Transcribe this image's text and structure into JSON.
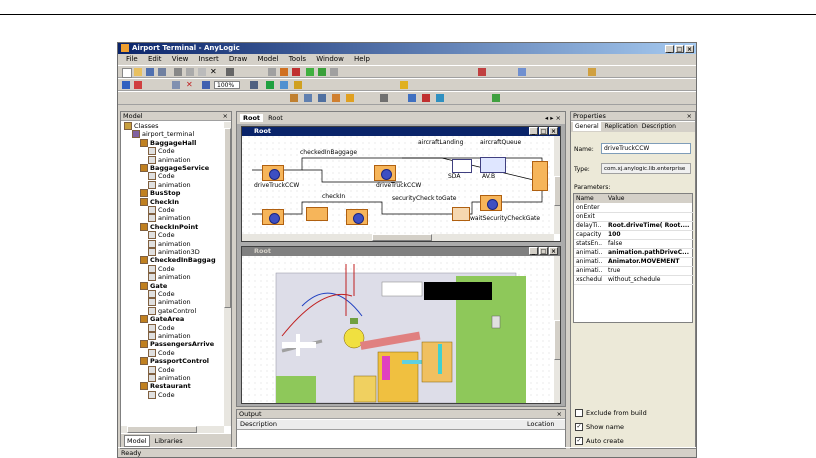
{
  "window": {
    "title": "Airport Terminal - AnyLogic"
  },
  "menu": [
    "File",
    "Edit",
    "View",
    "Insert",
    "Draw",
    "Model",
    "Tools",
    "Window",
    "Help"
  ],
  "toolbar": {
    "zoom": "100%"
  },
  "model_panel": {
    "title": "Model",
    "tree": [
      {
        "label": "Classes",
        "level": 0,
        "bold": false
      },
      {
        "label": "airport_terminal",
        "level": 1,
        "bold": false
      },
      {
        "label": "BaggageHall",
        "level": 2,
        "bold": true
      },
      {
        "label": "Code",
        "level": 3,
        "bold": false
      },
      {
        "label": "animation",
        "level": 3,
        "bold": false
      },
      {
        "label": "BaggageService",
        "level": 2,
        "bold": true
      },
      {
        "label": "Code",
        "level": 3,
        "bold": false
      },
      {
        "label": "animation",
        "level": 3,
        "bold": false
      },
      {
        "label": "BusStop",
        "level": 2,
        "bold": true
      },
      {
        "label": "CheckIn",
        "level": 2,
        "bold": true
      },
      {
        "label": "Code",
        "level": 3,
        "bold": false
      },
      {
        "label": "animation",
        "level": 3,
        "bold": false
      },
      {
        "label": "CheckInPoint",
        "level": 2,
        "bold": true
      },
      {
        "label": "Code",
        "level": 3,
        "bold": false
      },
      {
        "label": "animation",
        "level": 3,
        "bold": false
      },
      {
        "label": "animation3D",
        "level": 3,
        "bold": false
      },
      {
        "label": "CheckedInBaggag",
        "level": 2,
        "bold": true
      },
      {
        "label": "Code",
        "level": 3,
        "bold": false
      },
      {
        "label": "animation",
        "level": 3,
        "bold": false
      },
      {
        "label": "Gate",
        "level": 2,
        "bold": true
      },
      {
        "label": "Code",
        "level": 3,
        "bold": false
      },
      {
        "label": "animation",
        "level": 3,
        "bold": false
      },
      {
        "label": "gateControl",
        "level": 3,
        "bold": false
      },
      {
        "label": "GateArea",
        "level": 2,
        "bold": true
      },
      {
        "label": "Code",
        "level": 3,
        "bold": false
      },
      {
        "label": "animation",
        "level": 3,
        "bold": false
      },
      {
        "label": "PassengersArrive",
        "level": 2,
        "bold": true
      },
      {
        "label": "Code",
        "level": 3,
        "bold": false
      },
      {
        "label": "PassportControl",
        "level": 2,
        "bold": true
      },
      {
        "label": "Code",
        "level": 3,
        "bold": false
      },
      {
        "label": "animation",
        "level": 3,
        "bold": false
      },
      {
        "label": "Restaurant",
        "level": 2,
        "bold": true
      },
      {
        "label": "Code",
        "level": 3,
        "bold": false
      }
    ],
    "tabs": [
      "Model",
      "Libraries"
    ]
  },
  "editor": {
    "tab": "Root",
    "tab2": "Root",
    "root_window_title": "Root",
    "diagram_labels": [
      "checkedInBaggage",
      "aircraftLanding",
      "aircraftQueue",
      "driveTruckCCW",
      "driveTruckCCW",
      "SDA",
      "AV.B",
      "checkIn",
      "securityCheck",
      "toGate",
      "waitSecurityCheckGate"
    ],
    "anim_window_title": "Root"
  },
  "output_panel": {
    "title": "Output",
    "col_description": "Description",
    "col_location": "Location"
  },
  "properties": {
    "title": "Properties",
    "tabs": [
      "General",
      "Replication",
      "Description"
    ],
    "name_label": "Name:",
    "name_value": "driveTruckCCW",
    "type_label": "Type:",
    "type_value": "com.xj.anylogic.lib.enterprise",
    "params_label": "Parameters:",
    "col_name": "Name",
    "col_value": "Value",
    "rows": [
      {
        "name": "onEnter",
        "value": ""
      },
      {
        "name": "onExit",
        "value": ""
      },
      {
        "name": "delayTi...",
        "value": "Root.driveTime( Root...."
      },
      {
        "name": "capacity",
        "value": "100"
      },
      {
        "name": "statsEn...",
        "value": "false"
      },
      {
        "name": "animati...",
        "value": "animation.pathDriveC..."
      },
      {
        "name": "animati...",
        "value": "Animator.MOVEMENT"
      },
      {
        "name": "animati...",
        "value": "true"
      },
      {
        "name": "xschedule",
        "value": "without_schedule"
      }
    ],
    "exclude_label": "Exclude from build",
    "show_name_label": "Show name",
    "auto_create_label": "Auto create"
  },
  "status": {
    "text": "Ready"
  }
}
